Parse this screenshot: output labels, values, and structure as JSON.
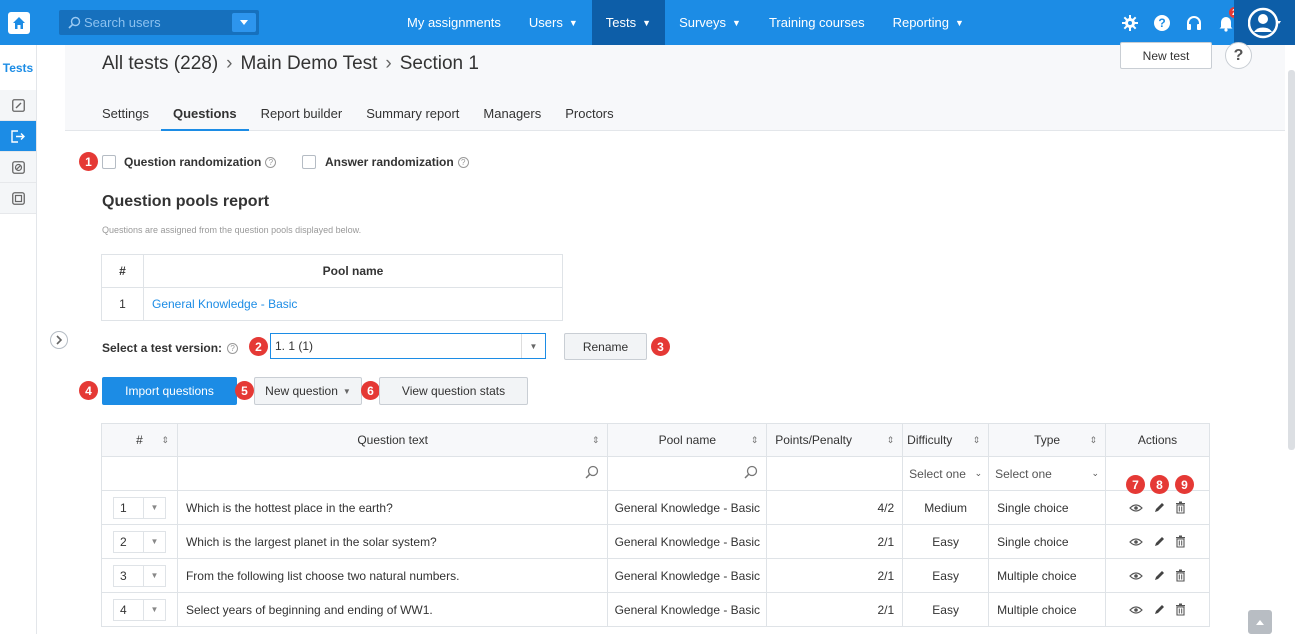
{
  "topbar": {
    "search_placeholder": "Search users",
    "nav": [
      {
        "label": "My assignments",
        "caret": false,
        "active": false
      },
      {
        "label": "Users",
        "caret": true,
        "active": false
      },
      {
        "label": "Tests",
        "caret": true,
        "active": true
      },
      {
        "label": "Surveys",
        "caret": true,
        "active": false
      },
      {
        "label": "Training courses",
        "caret": false,
        "active": false
      },
      {
        "label": "Reporting",
        "caret": true,
        "active": false
      }
    ],
    "notification_count": "26"
  },
  "sidebar": {
    "title": "Tests"
  },
  "header": {
    "breadcrumb": [
      "All tests (228)",
      "Main Demo Test",
      "Section 1"
    ],
    "breadcrumb_sep": "›",
    "new_test_label": "New test",
    "help_label": "?",
    "tabs": [
      "Settings",
      "Questions",
      "Report builder",
      "Summary report",
      "Managers",
      "Proctors"
    ]
  },
  "markers": [
    "1",
    "2",
    "3",
    "4",
    "5",
    "6",
    "7",
    "8",
    "9"
  ],
  "options": {
    "question_randomization": "Question randomization",
    "answer_randomization": "Answer randomization"
  },
  "pools": {
    "title": "Question pools report",
    "subtitle": "Questions are assigned from the question pools displayed below.",
    "col_num": "#",
    "col_name": "Pool name",
    "rows": [
      {
        "num": "1",
        "name": "General Knowledge - Basic"
      }
    ]
  },
  "version": {
    "label": "Select a test version:",
    "value": "1. 1 (1)",
    "rename_label": "Rename"
  },
  "buttons": {
    "import": "Import questions",
    "new_question": "New question",
    "view_stats": "View question stats"
  },
  "table": {
    "headers": {
      "num": "#",
      "text": "Question text",
      "pool": "Pool name",
      "points": "Points/Penalty",
      "difficulty": "Difficulty",
      "type": "Type",
      "actions": "Actions"
    },
    "filter_difficulty": "Select one",
    "filter_type": "Select one",
    "rows": [
      {
        "num": "1",
        "text": "Which is the hottest place in the earth?",
        "pool": "General Knowledge - Basic",
        "points": "4/2",
        "difficulty": "Medium",
        "type": "Single choice"
      },
      {
        "num": "2",
        "text": "Which is the largest planet in the solar system?",
        "pool": "General Knowledge - Basic",
        "points": "2/1",
        "difficulty": "Easy",
        "type": "Single choice"
      },
      {
        "num": "3",
        "text": "From the following list choose two natural numbers.",
        "pool": "General Knowledge - Basic",
        "points": "2/1",
        "difficulty": "Easy",
        "type": "Multiple choice"
      },
      {
        "num": "4",
        "text": "Select years of beginning and ending of WW1.",
        "pool": "General Knowledge - Basic",
        "points": "2/1",
        "difficulty": "Easy",
        "type": "Multiple choice"
      }
    ]
  },
  "colors": {
    "accent": "#1c8ce5",
    "nav_active": "#0d5ea8",
    "marker": "#e53935"
  }
}
